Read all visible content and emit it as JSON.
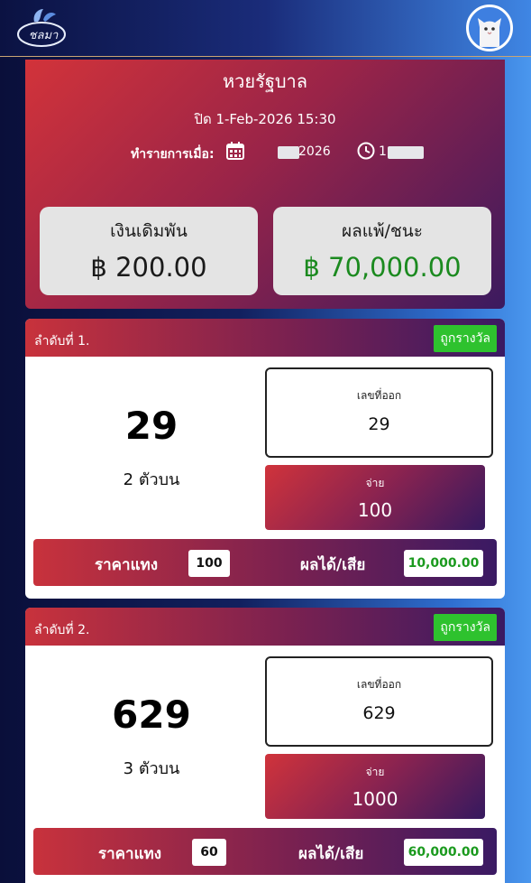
{
  "header": {
    "logo_text": "ชลมา",
    "avatar_icon": "cat-avatar-icon"
  },
  "summary": {
    "title": "หวยรัฐบาล",
    "close_time": "ปิด 1-Feb-2026 15:30",
    "transaction_label": "ทำรายการเมื่อ:",
    "transaction_date": "2026",
    "transaction_time": "1",
    "stake_label": "เงินเดิมพัน",
    "stake_value": "฿ 200.00",
    "result_label": "ผลแพ้/ชนะ",
    "result_value": "฿ 70,000.00",
    "result_color": "#1b8a1f"
  },
  "bets": [
    {
      "rank": "ลำดับที่ 1.",
      "badge": "ถูกรางวัล",
      "number": "29",
      "bet_type": "2 ตัวบน",
      "drawn_label": "เลขที่ออก",
      "drawn_value": "29",
      "pay_label": "จ่าย",
      "pay_value": "100",
      "price_label": "ราคาแทง",
      "price_value": "100",
      "profit_label": "ผลได้/เสีย",
      "profit_value": "10,000.00"
    },
    {
      "rank": "ลำดับที่ 2.",
      "badge": "ถูกรางวัล",
      "number": "629",
      "bet_type": "3 ตัวบน",
      "drawn_label": "เลขที่ออก",
      "drawn_value": "629",
      "pay_label": "จ่าย",
      "pay_value": "1000",
      "price_label": "ราคาแทง",
      "price_value": "60",
      "profit_label": "ผลได้/เสีย",
      "profit_value": "60,000.00"
    }
  ],
  "colors": {
    "badge": "#2ec22e",
    "profit": "#1b9a1e"
  }
}
